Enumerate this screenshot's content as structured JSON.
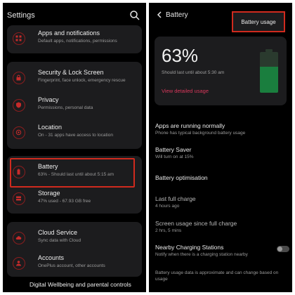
{
  "settings": {
    "title": "Settings",
    "group1": [
      {
        "title": "Apps and notifications",
        "subtitle": "Default apps, notifications, permissions",
        "icon": "apps-icon"
      }
    ],
    "group2": [
      {
        "title": "Security & Lock Screen",
        "subtitle": "Fingerprint, face unlock, emergency rescue",
        "icon": "lock-icon"
      },
      {
        "title": "Privacy",
        "subtitle": "Permissions, personal data",
        "icon": "privacy-icon"
      },
      {
        "title": "Location",
        "subtitle": "On - 31 apps have access to location",
        "icon": "location-icon"
      }
    ],
    "group3": [
      {
        "title": "Battery",
        "subtitle": "63% - Should last until about 5:15 am",
        "icon": "battery-icon"
      },
      {
        "title": "Storage",
        "subtitle": "47% used - 67.93 GB free",
        "icon": "storage-icon"
      }
    ],
    "group4": [
      {
        "title": "Cloud Service",
        "subtitle": "Sync data with Cloud",
        "icon": "cloud-icon"
      },
      {
        "title": "Accounts",
        "subtitle": "OnePlus account, other accounts",
        "icon": "account-icon"
      }
    ],
    "bottom_item": "Digital Wellbeing and parental controls"
  },
  "battery": {
    "title": "Battery",
    "usage_button": "Battery usage",
    "percent": "63%",
    "level": 0.63,
    "last_until": "Should last until about 5:30 am",
    "view_detailed": "View detailed usage",
    "items": [
      {
        "title": "Apps are running normally",
        "subtitle": "Phone has typical background battery usage"
      },
      {
        "title": "Battery Saver",
        "subtitle": "Will turn on at 15%"
      },
      {
        "title": "Battery optimisation",
        "subtitle": ""
      },
      {
        "title": "Last full charge",
        "subtitle": "4 hours ago"
      },
      {
        "title": "Screen usage since full charge",
        "subtitle": "2 hrs, 5 mins"
      },
      {
        "title": "Nearby Charging Stations",
        "subtitle": "Notify when there is a charging station nearby"
      }
    ],
    "note": "Battery usage data is approximate and can change based on usage"
  },
  "colors": {
    "accent": "#d02a1e",
    "link": "#d8375b",
    "battery_fill": "#1a7e3e",
    "icon_ring": "#8b1e1e"
  }
}
